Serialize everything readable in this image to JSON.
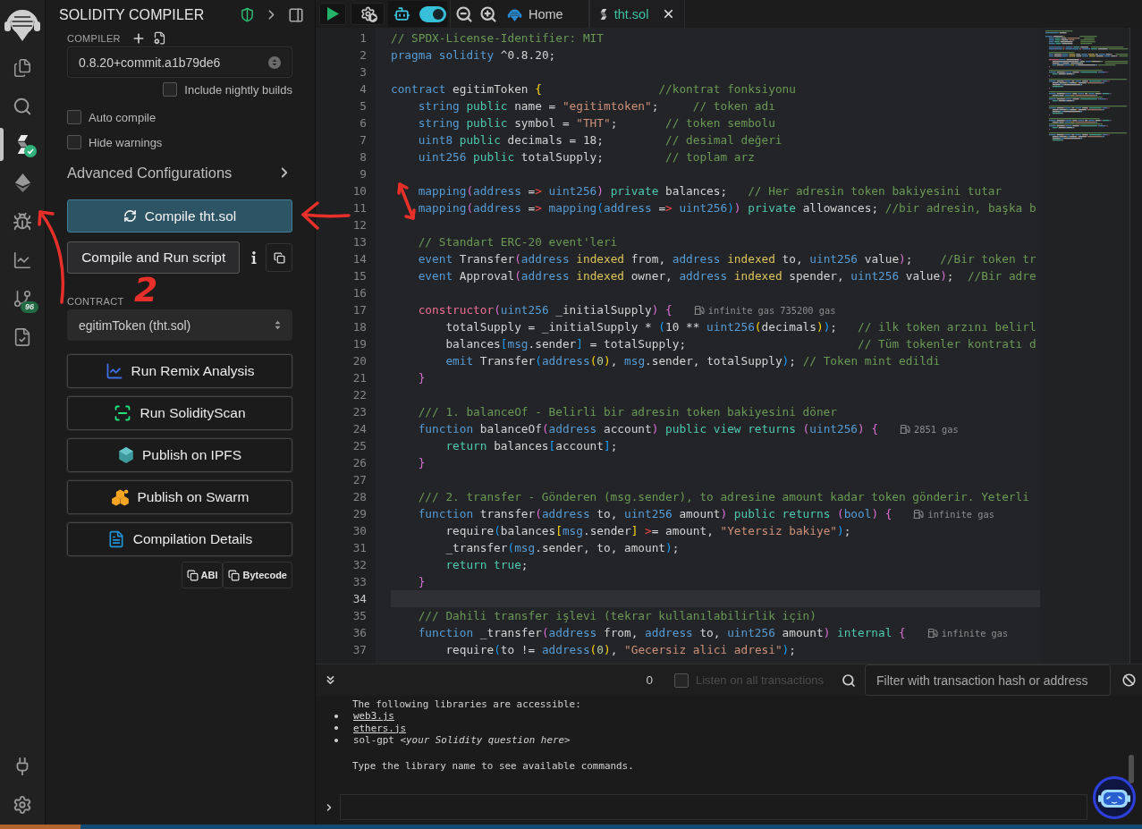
{
  "icon_bar": {
    "items": [
      {
        "selected": false,
        "compiled": false
      },
      {
        "selected": false,
        "compiled": false
      },
      {
        "selected": true,
        "compiled": true
      },
      {
        "selected": false,
        "compiled": false
      },
      {
        "selected": false,
        "compiled": false
      },
      {
        "selected": false,
        "compiled": false
      },
      {
        "selected": false,
        "compiled": false,
        "badge": "96"
      },
      {
        "selected": false,
        "compiled": false
      }
    ],
    "bottom_items": [
      {
        "selected": false
      },
      {
        "selected": false
      }
    ]
  },
  "compiler_panel": {
    "title": "SOLIDITY COMPILER",
    "compiler_label": "COMPILER",
    "version": {
      "value": "0.8.20+commit.a1b79de6"
    },
    "nightly": {
      "label": "Include nightly builds",
      "checked": false
    },
    "options": [
      {
        "label": "Auto compile",
        "checked": false
      },
      {
        "label": "Hide warnings",
        "checked": false
      }
    ],
    "advanced": {
      "label": "Advanced Configurations",
      "expanded": false
    },
    "compile_button": "Compile tht.sol",
    "script_button": "Compile and Run script",
    "contract_label": "CONTRACT",
    "contract": {
      "value": "egitimToken (tht.sol)"
    },
    "actions": [
      "Run Remix Analysis",
      "Run SolidityScan",
      "Publish on IPFS",
      "Publish on Swarm",
      "Compilation Details"
    ],
    "copy_buttons": [
      "ABI",
      "Bytecode"
    ]
  },
  "editor": {
    "ai_toggle": {
      "on": true
    },
    "tabs": [
      {
        "kind": "home",
        "label": "Home",
        "selected": false
      },
      {
        "kind": "file",
        "label": "tht.sol",
        "selected": true
      }
    ],
    "lines": [
      {
        "number": "1",
        "current": false,
        "tokens": [
          {
            "kind": "comment",
            "text": "// SPDX-License-Identifier: MIT"
          }
        ]
      },
      {
        "number": "2",
        "current": false,
        "tokens": [
          {
            "kind": "keyword",
            "text": "pragma solidity"
          },
          {
            "kind": "plain",
            "text": " ^0.8.20;"
          }
        ]
      },
      {
        "number": "3",
        "current": false
      },
      {
        "number": "4",
        "current": false,
        "tokens": [
          {
            "kind": "keyword",
            "text": "contract"
          },
          {
            "kind": "plain",
            "text": " egitimToken "
          },
          {
            "kind": "bracket1",
            "text": "{                 "
          },
          {
            "kind": "comment",
            "text": "//kontrat fonksiyonu"
          }
        ]
      },
      {
        "number": "5",
        "current": false,
        "tokens": [
          {
            "kind": "keyword",
            "text": "    string "
          },
          {
            "kind": "modifier",
            "text": "public"
          },
          {
            "kind": "plain",
            "text": " name = "
          },
          {
            "kind": "string",
            "text": "\"egitimtoken\""
          },
          {
            "kind": "plain",
            "text": ";     "
          },
          {
            "kind": "comment",
            "text": "// token adı"
          }
        ]
      },
      {
        "number": "6",
        "current": false,
        "tokens": [
          {
            "kind": "keyword",
            "text": "    string "
          },
          {
            "kind": "modifier",
            "text": "public"
          },
          {
            "kind": "plain",
            "text": " symbol = "
          },
          {
            "kind": "string",
            "text": "\"THT\""
          },
          {
            "kind": "plain",
            "text": ";       "
          },
          {
            "kind": "comment",
            "text": "// token sembolu"
          }
        ]
      },
      {
        "number": "7",
        "current": false,
        "tokens": [
          {
            "kind": "keyword",
            "text": "    uint8 "
          },
          {
            "kind": "modifier",
            "text": "public"
          },
          {
            "kind": "plain",
            "text": " decimals = 18;         "
          },
          {
            "kind": "comment",
            "text": "// desimal değeri"
          }
        ]
      },
      {
        "number": "8",
        "current": false,
        "tokens": [
          {
            "kind": "keyword",
            "text": "    uint256 "
          },
          {
            "kind": "modifier",
            "text": "public"
          },
          {
            "kind": "plain",
            "text": " totalSupply;         "
          },
          {
            "kind": "comment",
            "text": "// toplam arz"
          }
        ]
      },
      {
        "number": "9",
        "current": false
      },
      {
        "number": "10",
        "current": false,
        "tokens": [
          {
            "kind": "keyword",
            "text": "    mapping"
          },
          {
            "kind": "bracket2",
            "text": "("
          },
          {
            "kind": "keyword",
            "text": "address"
          },
          {
            "kind": "plain",
            "text": " ="
          },
          {
            "kind": "operator",
            "text": "> "
          },
          {
            "kind": "keyword",
            "text": "uint256"
          },
          {
            "kind": "bracket2",
            "text": ") "
          },
          {
            "kind": "modifier",
            "text": "private"
          },
          {
            "kind": "plain",
            "text": " balances;   "
          },
          {
            "kind": "comment",
            "text": "// Her adresin token bakiyesini tutar"
          }
        ]
      },
      {
        "number": "11",
        "current": false,
        "tokens": [
          {
            "kind": "keyword",
            "text": "    mapping"
          },
          {
            "kind": "bracket2",
            "text": "("
          },
          {
            "kind": "keyword",
            "text": "address"
          },
          {
            "kind": "plain",
            "text": " ="
          },
          {
            "kind": "operator",
            "text": "> "
          },
          {
            "kind": "keyword",
            "text": "mapping"
          },
          {
            "kind": "bracket3",
            "text": "("
          },
          {
            "kind": "keyword",
            "text": "address"
          },
          {
            "kind": "plain",
            "text": " ="
          },
          {
            "kind": "operator",
            "text": "> "
          },
          {
            "kind": "keyword",
            "text": "uint256"
          },
          {
            "kind": "bracket3",
            "text": ")"
          },
          {
            "kind": "bracket2",
            "text": ") "
          },
          {
            "kind": "modifier",
            "text": "private"
          },
          {
            "kind": "plain",
            "text": " allowances; "
          },
          {
            "kind": "comment",
            "text": "//bir adresin, başka b"
          }
        ]
      },
      {
        "number": "12",
        "current": false
      },
      {
        "number": "13",
        "current": false,
        "tokens": [
          {
            "kind": "comment",
            "text": "    // Standart ERC-20 event'leri"
          }
        ]
      },
      {
        "number": "14",
        "current": false,
        "tokens": [
          {
            "kind": "keyword",
            "text": "    event"
          },
          {
            "kind": "plain",
            "text": " Transfer"
          },
          {
            "kind": "bracket2",
            "text": "("
          },
          {
            "kind": "keyword",
            "text": "address "
          },
          {
            "kind": "accent",
            "text": "indexed"
          },
          {
            "kind": "plain",
            "text": " from, "
          },
          {
            "kind": "keyword",
            "text": "address "
          },
          {
            "kind": "accent",
            "text": "indexed"
          },
          {
            "kind": "plain",
            "text": " to, "
          },
          {
            "kind": "keyword",
            "text": "uint256"
          },
          {
            "kind": "plain",
            "text": " value"
          },
          {
            "kind": "bracket2",
            "text": ")"
          },
          {
            "kind": "plain",
            "text": ";    "
          },
          {
            "kind": "comment",
            "text": "//Bir token tr"
          }
        ]
      },
      {
        "number": "15",
        "current": false,
        "tokens": [
          {
            "kind": "keyword",
            "text": "    event"
          },
          {
            "kind": "plain",
            "text": " Approval"
          },
          {
            "kind": "bracket2",
            "text": "("
          },
          {
            "kind": "keyword",
            "text": "address "
          },
          {
            "kind": "accent",
            "text": "indexed"
          },
          {
            "kind": "plain",
            "text": " owner, "
          },
          {
            "kind": "keyword",
            "text": "address "
          },
          {
            "kind": "accent",
            "text": "indexed"
          },
          {
            "kind": "plain",
            "text": " spender, "
          },
          {
            "kind": "keyword",
            "text": "uint256"
          },
          {
            "kind": "plain",
            "text": " value"
          },
          {
            "kind": "bracket2",
            "text": ")"
          },
          {
            "kind": "plain",
            "text": ";  "
          },
          {
            "kind": "comment",
            "text": "//Bir adre"
          }
        ]
      },
      {
        "number": "16",
        "current": false
      },
      {
        "number": "17",
        "current": false,
        "gas": "infinite gas 735200 gas",
        "tokens": [
          {
            "kind": "function",
            "text": "    constructor"
          },
          {
            "kind": "bracket2",
            "text": "("
          },
          {
            "kind": "keyword",
            "text": "uint256"
          },
          {
            "kind": "plain",
            "text": " _initialSupply"
          },
          {
            "kind": "bracket2",
            "text": ") "
          },
          {
            "kind": "bracket2",
            "text": "{"
          }
        ]
      },
      {
        "number": "18",
        "current": false,
        "tokens": [
          {
            "kind": "plain",
            "text": "        totalSupply = _initialSupply * "
          },
          {
            "kind": "bracket3",
            "text": "("
          },
          {
            "kind": "plain",
            "text": "10 ** "
          },
          {
            "kind": "keyword",
            "text": "uint256"
          },
          {
            "kind": "bracket1",
            "text": "("
          },
          {
            "kind": "plain",
            "text": "decimals"
          },
          {
            "kind": "bracket1",
            "text": ")"
          },
          {
            "kind": "bracket3",
            "text": ")"
          },
          {
            "kind": "plain",
            "text": ";   "
          },
          {
            "kind": "comment",
            "text": "// ilk token arzını belirl"
          }
        ]
      },
      {
        "number": "19",
        "current": false,
        "tokens": [
          {
            "kind": "plain",
            "text": "        balances"
          },
          {
            "kind": "bracket3",
            "text": "["
          },
          {
            "kind": "keyword",
            "text": "msg"
          },
          {
            "kind": "plain",
            "text": ".sender"
          },
          {
            "kind": "bracket3",
            "text": "]"
          },
          {
            "kind": "plain",
            "text": " = totalSupply;                         "
          },
          {
            "kind": "comment",
            "text": "// Tüm tokenler kontratı d"
          }
        ]
      },
      {
        "number": "20",
        "current": false,
        "tokens": [
          {
            "kind": "keyword",
            "text": "        emit"
          },
          {
            "kind": "plain",
            "text": " Transfer"
          },
          {
            "kind": "bracket3",
            "text": "("
          },
          {
            "kind": "keyword",
            "text": "address"
          },
          {
            "kind": "bracket1",
            "text": "("
          },
          {
            "kind": "number",
            "text": "0"
          },
          {
            "kind": "bracket1",
            "text": ")"
          },
          {
            "kind": "plain",
            "text": ", "
          },
          {
            "kind": "keyword",
            "text": "msg"
          },
          {
            "kind": "plain",
            "text": ".sender, totalSupply"
          },
          {
            "kind": "bracket3",
            "text": ")"
          },
          {
            "kind": "plain",
            "text": "; "
          },
          {
            "kind": "comment",
            "text": "// Token mint edildi"
          }
        ]
      },
      {
        "number": "21",
        "current": false,
        "tokens": [
          {
            "kind": "bracket2",
            "text": "    }"
          }
        ]
      },
      {
        "number": "22",
        "current": false
      },
      {
        "number": "23",
        "current": false,
        "tokens": [
          {
            "kind": "comment",
            "text": "    /// 1. balanceOf - Belirli bir adresin token bakiyesini döner"
          }
        ]
      },
      {
        "number": "24",
        "current": false,
        "gas": "2851 gas",
        "tokens": [
          {
            "kind": "keyword",
            "text": "    function"
          },
          {
            "kind": "plain",
            "text": " balanceOf"
          },
          {
            "kind": "bracket2",
            "text": "("
          },
          {
            "kind": "keyword",
            "text": "address"
          },
          {
            "kind": "plain",
            "text": " account"
          },
          {
            "kind": "bracket2",
            "text": ") "
          },
          {
            "kind": "modifier",
            "text": "public view returns "
          },
          {
            "kind": "bracket2",
            "text": "("
          },
          {
            "kind": "keyword",
            "text": "uint256"
          },
          {
            "kind": "bracket2",
            "text": ") "
          },
          {
            "kind": "bracket2",
            "text": "{"
          }
        ]
      },
      {
        "number": "25",
        "current": false,
        "tokens": [
          {
            "kind": "modifier",
            "text": "        return"
          },
          {
            "kind": "plain",
            "text": " balances"
          },
          {
            "kind": "bracket3",
            "text": "["
          },
          {
            "kind": "plain",
            "text": "account"
          },
          {
            "kind": "bracket3",
            "text": "]"
          },
          {
            "kind": "plain",
            "text": ";"
          }
        ]
      },
      {
        "number": "26",
        "current": false,
        "tokens": [
          {
            "kind": "bracket2",
            "text": "    }"
          }
        ]
      },
      {
        "number": "27",
        "current": false
      },
      {
        "number": "28",
        "current": false,
        "tokens": [
          {
            "kind": "comment",
            "text": "    /// 2. transfer - Gönderen (msg.sender), to adresine amount kadar token gönderir. Yeterli"
          }
        ]
      },
      {
        "number": "29",
        "current": false,
        "gas": "infinite gas",
        "tokens": [
          {
            "kind": "keyword",
            "text": "    function"
          },
          {
            "kind": "plain",
            "text": " transfer"
          },
          {
            "kind": "bracket2",
            "text": "("
          },
          {
            "kind": "keyword",
            "text": "address"
          },
          {
            "kind": "plain",
            "text": " to, "
          },
          {
            "kind": "keyword",
            "text": "uint256"
          },
          {
            "kind": "plain",
            "text": " amount"
          },
          {
            "kind": "bracket2",
            "text": ") "
          },
          {
            "kind": "modifier",
            "text": "public returns "
          },
          {
            "kind": "bracket2",
            "text": "("
          },
          {
            "kind": "keyword",
            "text": "bool"
          },
          {
            "kind": "bracket2",
            "text": ") "
          },
          {
            "kind": "bracket2",
            "text": "{"
          }
        ]
      },
      {
        "number": "30",
        "current": false,
        "tokens": [
          {
            "kind": "plain",
            "text": "        require"
          },
          {
            "kind": "bracket3",
            "text": "("
          },
          {
            "kind": "plain",
            "text": "balances"
          },
          {
            "kind": "bracket1",
            "text": "["
          },
          {
            "kind": "keyword",
            "text": "msg"
          },
          {
            "kind": "plain",
            "text": ".sender"
          },
          {
            "kind": "bracket1",
            "text": "] "
          },
          {
            "kind": "operator",
            "text": ">"
          },
          {
            "kind": "plain",
            "text": "= amount, "
          },
          {
            "kind": "string",
            "text": "\"Yetersiz bakiye\""
          },
          {
            "kind": "bracket3",
            "text": ")"
          },
          {
            "kind": "plain",
            "text": ";"
          }
        ]
      },
      {
        "number": "31",
        "current": false,
        "tokens": [
          {
            "kind": "plain",
            "text": "        _transfer"
          },
          {
            "kind": "bracket3",
            "text": "("
          },
          {
            "kind": "keyword",
            "text": "msg"
          },
          {
            "kind": "plain",
            "text": ".sender, to, amount"
          },
          {
            "kind": "bracket3",
            "text": ")"
          },
          {
            "kind": "plain",
            "text": ";"
          }
        ]
      },
      {
        "number": "32",
        "current": false,
        "tokens": [
          {
            "kind": "modifier",
            "text": "        return true"
          },
          {
            "kind": "plain",
            "text": ";"
          }
        ]
      },
      {
        "number": "33",
        "current": false,
        "tokens": [
          {
            "kind": "bracket2",
            "text": "    }"
          }
        ]
      },
      {
        "number": "34",
        "current": true
      },
      {
        "number": "35",
        "current": false,
        "tokens": [
          {
            "kind": "comment",
            "text": "    /// Dahili transfer işlevi (tekrar kullanılabilirlik için)"
          }
        ]
      },
      {
        "number": "36",
        "current": false,
        "gas": "infinite gas",
        "tokens": [
          {
            "kind": "keyword",
            "text": "    function"
          },
          {
            "kind": "plain",
            "text": " _transfer"
          },
          {
            "kind": "bracket2",
            "text": "("
          },
          {
            "kind": "keyword",
            "text": "address"
          },
          {
            "kind": "plain",
            "text": " from, "
          },
          {
            "kind": "keyword",
            "text": "address"
          },
          {
            "kind": "plain",
            "text": " to, "
          },
          {
            "kind": "keyword",
            "text": "uint256"
          },
          {
            "kind": "plain",
            "text": " amount"
          },
          {
            "kind": "bracket2",
            "text": ") "
          },
          {
            "kind": "modifier",
            "text": "internal "
          },
          {
            "kind": "bracket2",
            "text": "{"
          }
        ]
      },
      {
        "number": "37",
        "current": false,
        "tokens": [
          {
            "kind": "plain",
            "text": "        require"
          },
          {
            "kind": "bracket3",
            "text": "("
          },
          {
            "kind": "plain",
            "text": "to != "
          },
          {
            "kind": "keyword",
            "text": "address"
          },
          {
            "kind": "bracket1",
            "text": "("
          },
          {
            "kind": "number",
            "text": "0"
          },
          {
            "kind": "bracket1",
            "text": ")"
          },
          {
            "kind": "plain",
            "text": ", "
          },
          {
            "kind": "string",
            "text": "\"Gecersiz alici adresi\""
          },
          {
            "kind": "bracket3",
            "text": ")"
          },
          {
            "kind": "plain",
            "text": ";"
          }
        ]
      }
    ]
  },
  "terminal": {
    "count": "0",
    "listen": {
      "label": "Listen on all transactions",
      "checked": false,
      "disabled": true
    },
    "filter": {
      "placeholder": "Filter with transaction hash or address"
    },
    "intro": "The following libraries are accessible:",
    "libraries": [
      {
        "kind": "link",
        "text": "web3.js"
      },
      {
        "kind": "link",
        "text": "ethers.js"
      },
      {
        "kind": "command",
        "text": "sol-gpt *<your Solidity question here>*"
      }
    ],
    "footer": "Type the library name to see available commands."
  },
  "annotation": {
    "number": "2"
  }
}
